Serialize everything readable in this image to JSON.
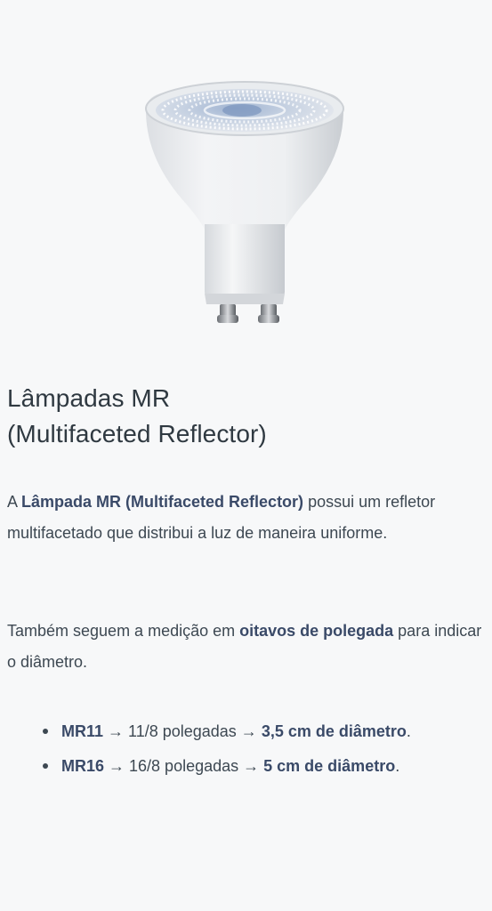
{
  "heading": {
    "line1": "Lâmpadas MR",
    "line2": "(Multifaceted Reflector)"
  },
  "paragraph1": {
    "pre": "A ",
    "bold": "Lâmpada MR (Multifaceted Reflector)",
    "post": " possui um refletor multifacetado que distribui a luz de maneira uniforme."
  },
  "paragraph2": {
    "pre": "Também seguem a medição em ",
    "bold": "oitavos de polegada",
    "post": " para indicar o diâmetro."
  },
  "list": [
    {
      "name": "MR11",
      "mid": " → 11/8 polegadas → ",
      "size": "3,5 cm de diâmetro",
      "end": "."
    },
    {
      "name": "MR16",
      "mid": " → 16/8 polegadas → ",
      "size": "5 cm de diâmetro",
      "end": "."
    }
  ],
  "image": {
    "icon": "gu10-led-bulb-illustration"
  }
}
